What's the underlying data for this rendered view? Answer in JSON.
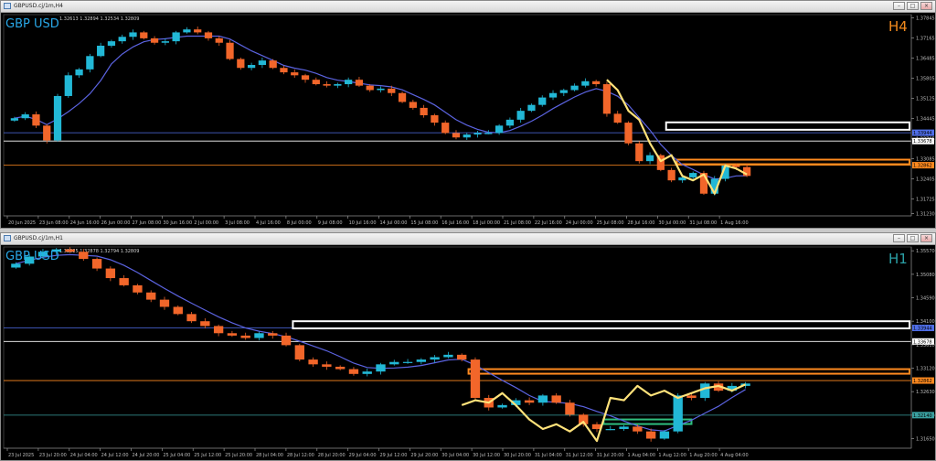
{
  "window_top": {
    "title": "GBPUSD.cj/1m,H4",
    "ohlc": "1.32613 1.32894 1.32534 1.32809"
  },
  "window_bottom": {
    "title": "GBPUSD.cj/1m,H1",
    "ohlc": "1.32825 1.32878 1.32794 1.32809"
  },
  "window_buttons": {
    "minimize": "–",
    "maximize": "□",
    "close": "×"
  },
  "chart_data": [
    {
      "type": "candlestick",
      "symbol_label": "GBP USD",
      "timeframe_label": "H4",
      "ylim": [
        1.3115,
        1.3795
      ],
      "y_ticks": [
        {
          "v": 1.37845,
          "label": "1.37845"
        },
        {
          "v": 1.37165,
          "label": "1.37165"
        },
        {
          "v": 1.36485,
          "label": "1.36485"
        },
        {
          "v": 1.35805,
          "label": "1.35805"
        },
        {
          "v": 1.35125,
          "label": "1.35125"
        },
        {
          "v": 1.34445,
          "label": "1.34445"
        },
        {
          "v": 1.33765,
          "label": "1.33765"
        },
        {
          "v": 1.33085,
          "label": "1.33085"
        },
        {
          "v": 1.32405,
          "label": "1.32405"
        },
        {
          "v": 1.31725,
          "label": "1.31725"
        },
        {
          "v": 1.3123,
          "label": "1.31230"
        }
      ],
      "x_labels": [
        "20 Jun 2025",
        "23 Jun 08:00",
        "24 Jun 16:00",
        "26 Jun 00:00",
        "27 Jun 08:00",
        "30 Jun 16:00",
        "2 Jul 00:00",
        "3 Jul 08:00",
        "4 Jul 16:00",
        "8 Jul 00:00",
        "9 Jul 08:00",
        "10 Jul 16:00",
        "14 Jul 00:00",
        "15 Jul 08:00",
        "16 Jul 16:00",
        "18 Jul 00:00",
        "21 Jul 08:00",
        "22 Jul 16:00",
        "24 Jul 00:00",
        "25 Jul 08:00",
        "28 Jul 16:00",
        "30 Jul 00:00",
        "31 Jul 08:00",
        "1 Aug 16:00"
      ],
      "price_series": [
        1.3445,
        1.3458,
        1.342,
        1.337,
        1.352,
        1.359,
        1.361,
        1.3655,
        1.369,
        1.3705,
        1.372,
        1.3735,
        1.3715,
        1.37,
        1.3705,
        1.3735,
        1.3745,
        1.3735,
        1.3715,
        1.37,
        1.3645,
        1.3615,
        1.3625,
        1.364,
        1.3615,
        1.36,
        1.359,
        1.3575,
        1.356,
        1.3555,
        1.356,
        1.3575,
        1.3555,
        1.354,
        1.3545,
        1.353,
        1.35,
        1.348,
        1.3455,
        1.343,
        1.3395,
        1.338,
        1.339,
        1.3395,
        1.3395,
        1.342,
        1.344,
        1.347,
        1.349,
        1.3515,
        1.353,
        1.354,
        1.3555,
        1.357,
        1.356,
        1.346,
        1.343,
        1.336,
        1.33,
        1.332,
        1.327,
        1.3235,
        1.3245,
        1.326,
        1.319,
        1.324,
        1.3285,
        1.328,
        1.325
      ],
      "zigzag": [
        1.3575,
        1.354,
        1.347,
        1.344,
        1.336,
        1.33,
        1.332,
        1.325,
        1.3235,
        1.3255,
        1.319,
        1.3285,
        1.3275,
        1.3255
      ],
      "hlines": [
        {
          "v": 1.3396,
          "color": "#4f6ee8",
          "label": "1.33944"
        },
        {
          "v": 1.33678,
          "color": "#ffffff",
          "label": "1.33678"
        },
        {
          "v": 1.32862,
          "color": "#ff8a1f",
          "label": "1.32862"
        }
      ],
      "zones": [
        {
          "color": "#ffffff",
          "y_top": 1.3431,
          "y_bottom": 1.3406,
          "from_index": 61,
          "to_index": 69
        },
        {
          "color": "#ff8a1f",
          "y_top": 1.3305,
          "y_bottom": 1.329,
          "from_index": 62,
          "to_index": 69
        }
      ]
    },
    {
      "type": "candlestick",
      "symbol_label": "GBP USD",
      "timeframe_label": "H1",
      "ylim": [
        1.3145,
        1.3565
      ],
      "y_ticks": [
        {
          "v": 1.3557,
          "label": "1.35570"
        },
        {
          "v": 1.3508,
          "label": "1.35080"
        },
        {
          "v": 1.3459,
          "label": "1.34590"
        },
        {
          "v": 1.341,
          "label": "1.34100"
        },
        {
          "v": 1.3361,
          "label": "1.33610"
        },
        {
          "v": 1.3312,
          "label": "1.33120"
        },
        {
          "v": 1.3263,
          "label": "1.32630"
        },
        {
          "v": 1.3214,
          "label": "1.32140"
        },
        {
          "v": 1.3165,
          "label": "1.31650"
        }
      ],
      "x_labels": [
        "23 Jul 2025",
        "23 Jul 20:00",
        "24 Jul 04:00",
        "24 Jul 12:00",
        "24 Jul 20:00",
        "25 Jul 04:00",
        "25 Jul 12:00",
        "25 Jul 20:00",
        "28 Jul 04:00",
        "28 Jul 12:00",
        "28 Jul 20:00",
        "29 Jul 04:00",
        "29 Jul 12:00",
        "29 Jul 20:00",
        "30 Jul 04:00",
        "30 Jul 12:00",
        "30 Jul 20:00",
        "31 Jul 04:00",
        "31 Jul 12:00",
        "31 Jul 20:00",
        "1 Aug 04:00",
        "1 Aug 12:00",
        "1 Aug 20:00",
        "4 Aug 04:00"
      ],
      "price_series": [
        1.353,
        1.3545,
        1.3555,
        1.356,
        1.3555,
        1.354,
        1.352,
        1.35,
        1.3485,
        1.347,
        1.3455,
        1.344,
        1.3425,
        1.341,
        1.34,
        1.3385,
        1.338,
        1.3375,
        1.3385,
        1.338,
        1.336,
        1.333,
        1.332,
        1.3315,
        1.331,
        1.33,
        1.3305,
        1.332,
        1.3325,
        1.3325,
        1.333,
        1.3335,
        1.334,
        1.333,
        1.325,
        1.323,
        1.3235,
        1.3245,
        1.324,
        1.3255,
        1.324,
        1.3215,
        1.3195,
        1.3185,
        1.3185,
        1.319,
        1.318,
        1.3165,
        1.318,
        1.3255,
        1.325,
        1.328,
        1.3265,
        1.3275,
        1.328
      ],
      "zigzag": [
        1.3235,
        1.3245,
        1.324,
        1.326,
        1.3235,
        1.3205,
        1.3185,
        1.3195,
        1.318,
        1.32,
        1.316,
        1.325,
        1.3245,
        1.3275,
        1.3255,
        1.3265,
        1.325,
        1.326,
        1.327,
        1.3275,
        1.3265,
        1.3278
      ],
      "hlines": [
        {
          "v": 1.3396,
          "color": "#4f6ee8",
          "label": "1.33944"
        },
        {
          "v": 1.33678,
          "color": "#ffffff",
          "label": "1.33678"
        },
        {
          "v": 1.32862,
          "color": "#ff8a1f",
          "label": "1.32862"
        },
        {
          "v": 1.3214,
          "color": "#3aa0a0",
          "label": "1.32140"
        }
      ],
      "zones": [
        {
          "color": "#ffffff",
          "y_top": 1.341,
          "y_bottom": 1.3395,
          "from_index": 21,
          "to_index": 54
        },
        {
          "color": "#ff8a1f",
          "y_top": 1.331,
          "y_bottom": 1.3302,
          "from_index": 34,
          "to_index": 54
        },
        {
          "color": "#2fbf7f",
          "y_top": 1.3205,
          "y_bottom": 1.3197,
          "from_index": 44,
          "to_index": 50
        }
      ]
    }
  ]
}
